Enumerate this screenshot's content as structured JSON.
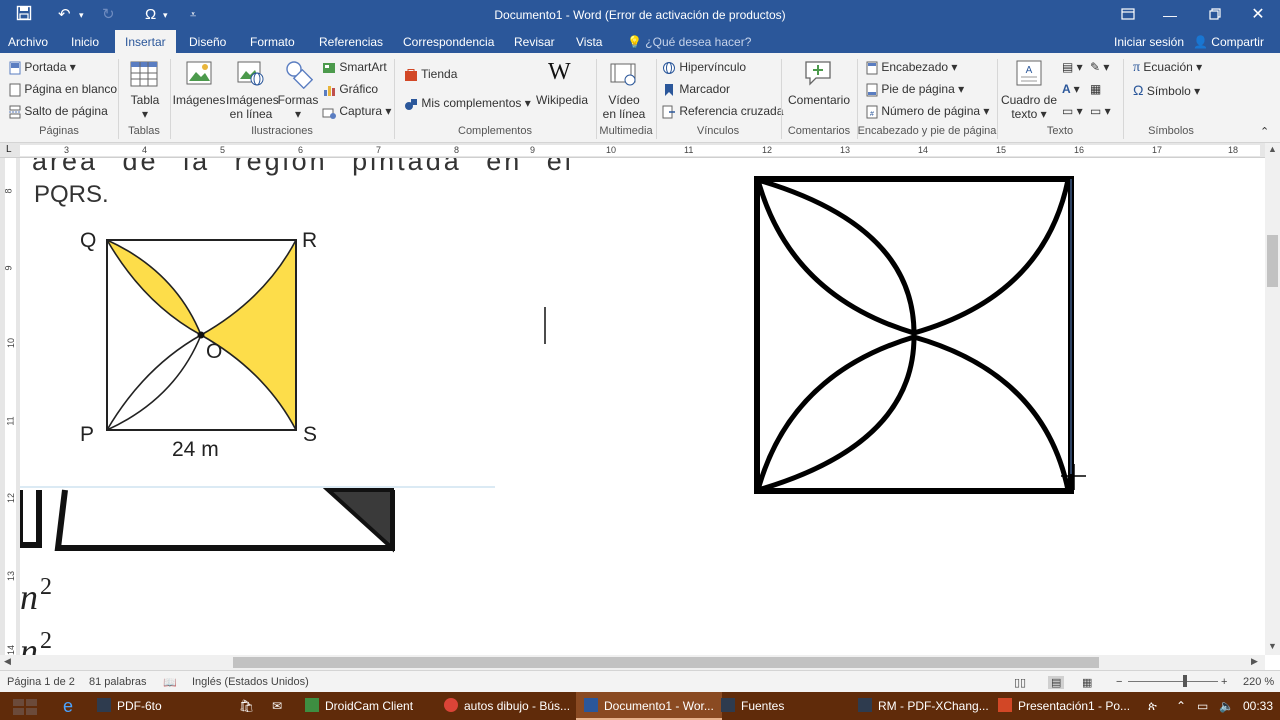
{
  "window": {
    "title": "Documento1 - Word (Error de activación de productos)"
  },
  "tabs": [
    {
      "label": "Archivo"
    },
    {
      "label": "Inicio"
    },
    {
      "label": "Insertar"
    },
    {
      "label": "Diseño"
    },
    {
      "label": "Formato"
    },
    {
      "label": "Referencias"
    },
    {
      "label": "Correspondencia"
    },
    {
      "label": "Revisar"
    },
    {
      "label": "Vista"
    }
  ],
  "tell_me": "¿Qué desea hacer?",
  "account": {
    "signin": "Iniciar sesión",
    "share": "Compartir"
  },
  "ribbon": {
    "paginas": {
      "portada": "Portada",
      "pagina_blanco": "Página en blanco",
      "salto": "Salto de página",
      "group": "Páginas"
    },
    "tablas": {
      "tabla": "Tabla",
      "group": "Tablas"
    },
    "ilustraciones": {
      "imagenes": "Imágenes",
      "imagenes_linea_1": "Imágenes",
      "imagenes_linea_2": "en línea",
      "formas": "Formas",
      "smartart": "SmartArt",
      "grafico": "Gráfico",
      "captura": "Captura",
      "group": "Ilustraciones"
    },
    "complementos": {
      "tienda": "Tienda",
      "mis": "Mis complementos",
      "wikipedia": "Wikipedia",
      "group": "Complementos"
    },
    "multimedia": {
      "video_1": "Vídeo",
      "video_2": "en línea",
      "group": "Multimedia"
    },
    "vinculos": {
      "hipervinculo": "Hipervínculo",
      "marcador": "Marcador",
      "referencia": "Referencia cruzada",
      "group": "Vínculos"
    },
    "comentarios": {
      "comentario": "Comentario",
      "group": "Comentarios"
    },
    "encabezado": {
      "encabezado": "Encabezado",
      "pie": "Pie de página",
      "numero": "Número de página",
      "group": "Encabezado y pie de página"
    },
    "texto": {
      "cuadro_1": "Cuadro de",
      "cuadro_2": "texto",
      "group": "Texto"
    },
    "simbolos": {
      "ecuacion": "Ecuación",
      "simbolo": "Símbolo",
      "group": "Símbolos"
    }
  },
  "ruler_numbers": [
    "3",
    "4",
    "5",
    "6",
    "7",
    "8",
    "9",
    "10",
    "11",
    "12",
    "13",
    "14",
    "15",
    "16",
    "17",
    "18"
  ],
  "vruler_numbers": [
    "8",
    "9",
    "10",
    "11",
    "12",
    "13",
    "14"
  ],
  "document": {
    "text_line_1": "área de la región pintada en el",
    "text_line_2": "PQRS.",
    "labels": {
      "q": "Q",
      "r": "R",
      "o": "O",
      "p": "P",
      "s": "S",
      "side": "24 m"
    },
    "math_1": "n",
    "math_1_exp": "2",
    "math_2": "n",
    "math_2_exp": "2"
  },
  "status": {
    "page": "Página 1 de 2",
    "words": "81 palabras",
    "language": "Inglés (Estados Unidos)",
    "zoom": "220 %"
  },
  "taskbar": {
    "items": [
      {
        "label": "PDF-6to"
      },
      {
        "label": "DroidCam Client"
      },
      {
        "label": "autos dibujo - Bús..."
      },
      {
        "label": "Documento1 - Wor..."
      },
      {
        "label": "Fuentes"
      },
      {
        "label": "RM - PDF-XChang..."
      },
      {
        "label": "Presentación1 - Po..."
      }
    ],
    "time": "00:33"
  },
  "colors": {
    "word_blue": "#2b579a",
    "taskbar": "#602b0a",
    "yellow_fill": "#fddd4a"
  }
}
